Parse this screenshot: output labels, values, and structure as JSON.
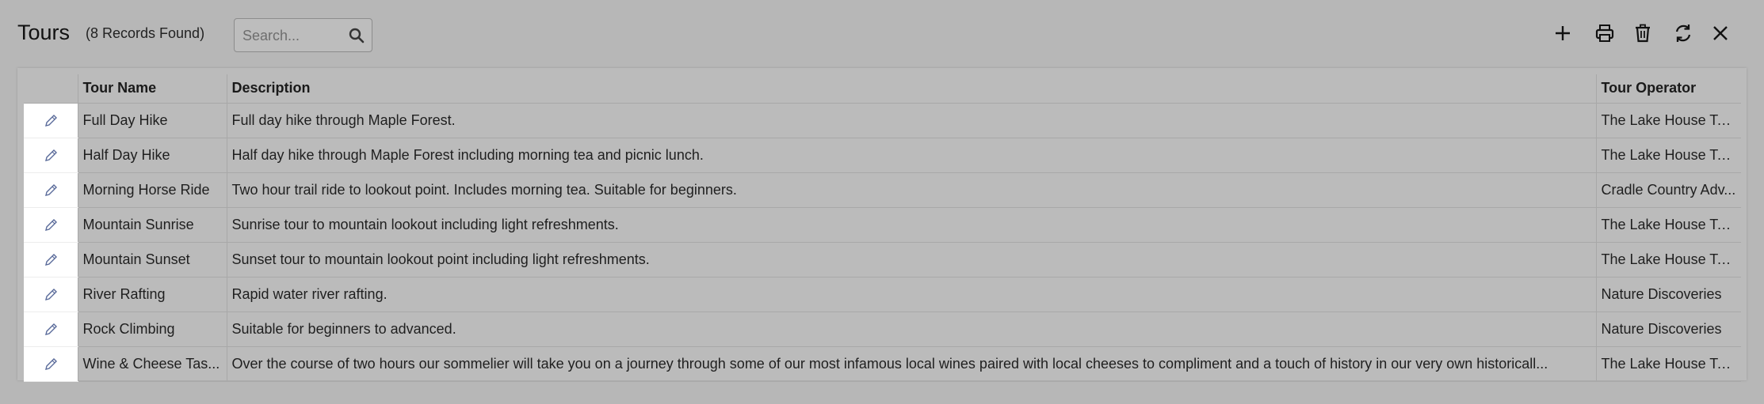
{
  "header": {
    "title": "Tours",
    "record_count": "(8 Records Found)",
    "search_placeholder": "Search..."
  },
  "toolbar": {
    "icons": [
      "plus-icon",
      "print-icon",
      "trash-icon",
      "refresh-icon",
      "close-icon"
    ]
  },
  "table": {
    "columns": [
      "",
      "Tour Name",
      "Description",
      "Tour Operator"
    ],
    "rows": [
      {
        "name": "Full Day Hike",
        "description": "Full day hike through Maple Forest.",
        "operator": "The Lake House To..."
      },
      {
        "name": "Half Day Hike",
        "description": "Half day hike through Maple Forest including morning tea and picnic lunch.",
        "operator": "The Lake House To..."
      },
      {
        "name": "Morning Horse Ride",
        "description": "Two hour trail ride to lookout point. Includes morning tea. Suitable for beginners.",
        "operator": "Cradle Country Adv..."
      },
      {
        "name": "Mountain Sunrise",
        "description": "Sunrise tour to mountain lookout including light refreshments.",
        "operator": "The Lake House To..."
      },
      {
        "name": "Mountain Sunset",
        "description": "Sunset tour to mountain lookout point including light refreshments.",
        "operator": "The Lake House To..."
      },
      {
        "name": "River Rafting",
        "description": "Rapid water river rafting.",
        "operator": "Nature Discoveries"
      },
      {
        "name": "Rock Climbing",
        "description": "Suitable for beginners to advanced.",
        "operator": "Nature Discoveries"
      },
      {
        "name": "Wine & Cheese Tas...",
        "description": "Over the course of two hours our sommelier will take you on a journey through some of our most infamous local wines paired with local cheeses to compliment and a touch of history in our very own historicall...",
        "operator": "The Lake House To..."
      }
    ]
  },
  "colors": {
    "background": "#b7b7b7",
    "edit_cell": "#ffffff",
    "edit_icon": "#5a6b9a"
  }
}
